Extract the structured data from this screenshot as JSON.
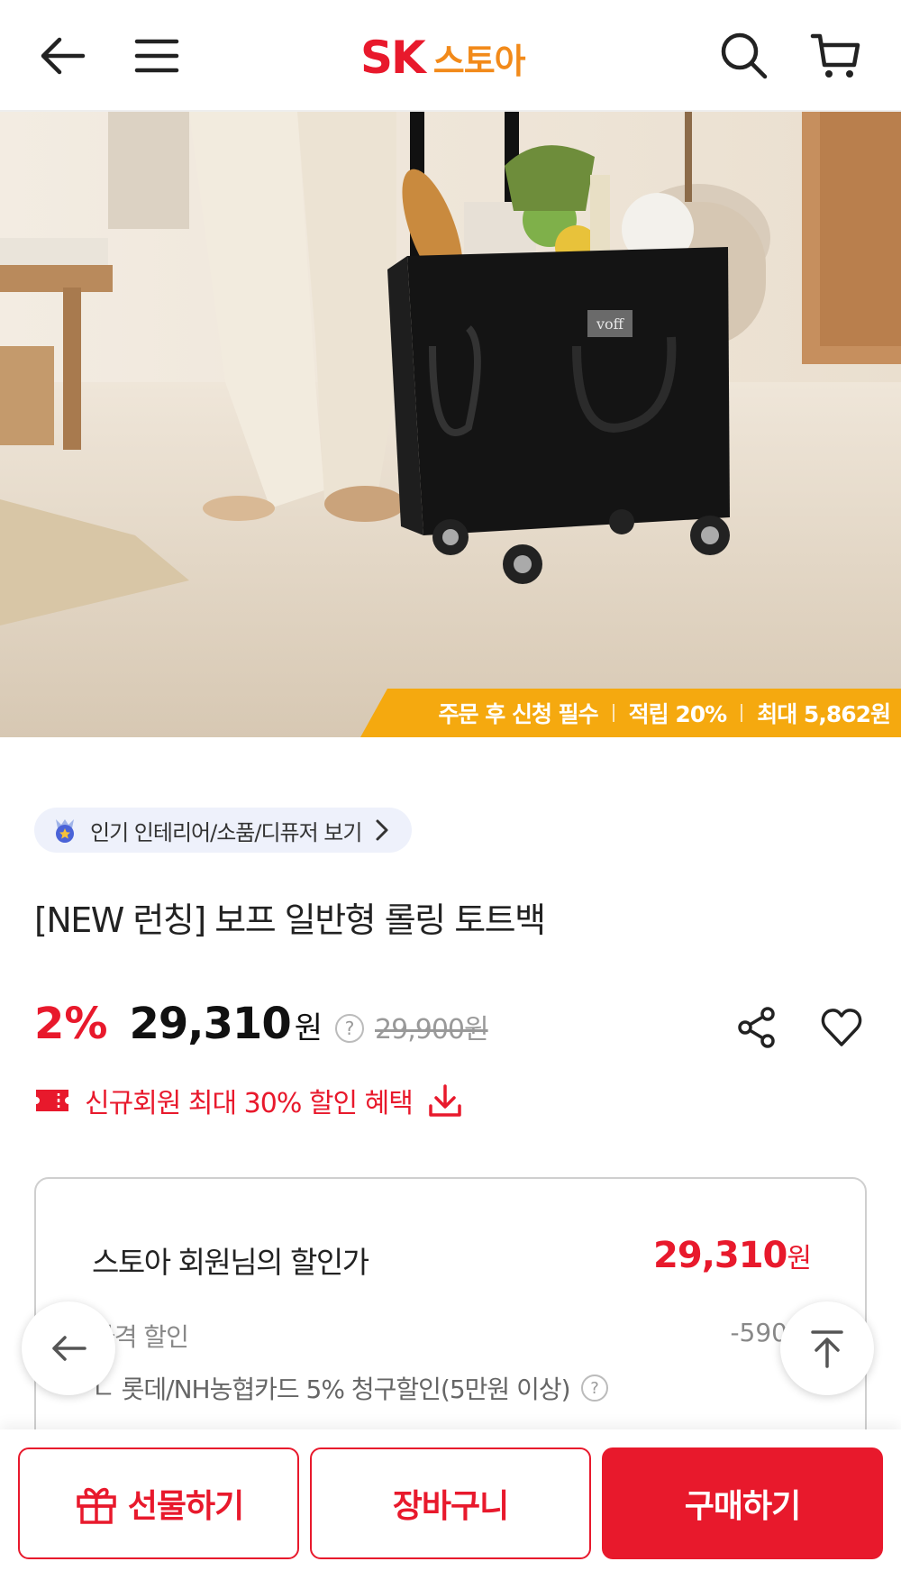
{
  "header": {
    "logo_sk": "SK",
    "logo_store": "스토아"
  },
  "hero": {
    "product_brand_tag": "voff",
    "promo": {
      "item1": "주문 후 신청 필수",
      "item2": "적립 20%",
      "item3": "최대 5,862원"
    }
  },
  "category_chip": {
    "label": "인기 인테리어/소품/디퓨저 보기"
  },
  "product": {
    "title": "[NEW 런칭] 보프 일반형 롤링 토트백",
    "discount_rate": "2%",
    "price": "29,310",
    "currency": "원",
    "help_symbol": "?",
    "original_price": "29,900원"
  },
  "coupon": {
    "label": "신규회원 최대 30% 할인 혜택"
  },
  "discount_box": {
    "title": "스토아 회원님의 할인가",
    "price": "29,310",
    "currency": "원",
    "line1_label": "가격 할인",
    "line1_value": "-590",
    "line2_label": "ㄴ 롯데/NH농협카드 5% 청구할인(5만원 이상)"
  },
  "bottom_bar": {
    "gift": "선물하기",
    "cart": "장바구니",
    "buy": "구매하기"
  },
  "colors": {
    "brand_red": "#e8192c",
    "brand_orange": "#f28a1a",
    "promo_bg": "#f5a90f"
  },
  "icons": [
    "back-arrow-icon",
    "menu-icon",
    "search-icon",
    "cart-icon",
    "badge-icon",
    "chevron-right-icon",
    "share-icon",
    "heart-icon",
    "coupon-icon",
    "download-icon",
    "gift-icon",
    "arrow-left-icon",
    "arrow-up-icon"
  ]
}
